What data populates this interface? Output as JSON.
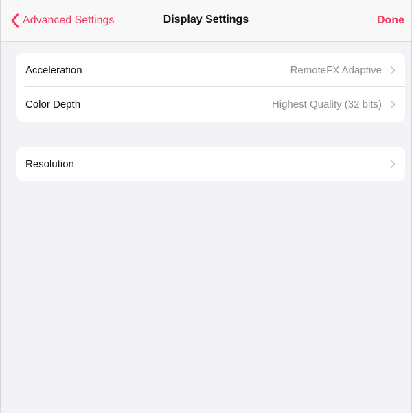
{
  "nav": {
    "back_label": "Advanced Settings",
    "title": "Display Settings",
    "done_label": "Done",
    "back_icon": "chevron-left-icon"
  },
  "groups": [
    {
      "rows": [
        {
          "label": "Acceleration",
          "value": "RemoteFX Adaptive"
        },
        {
          "label": "Color Depth",
          "value": "Highest Quality (32 bits)"
        }
      ]
    },
    {
      "rows": [
        {
          "label": "Resolution",
          "value": ""
        }
      ]
    }
  ],
  "colors": {
    "accent": "#ef3b5d",
    "background": "#f2f2f7",
    "cell": "#ffffff",
    "secondary_text": "#8e8e93"
  }
}
